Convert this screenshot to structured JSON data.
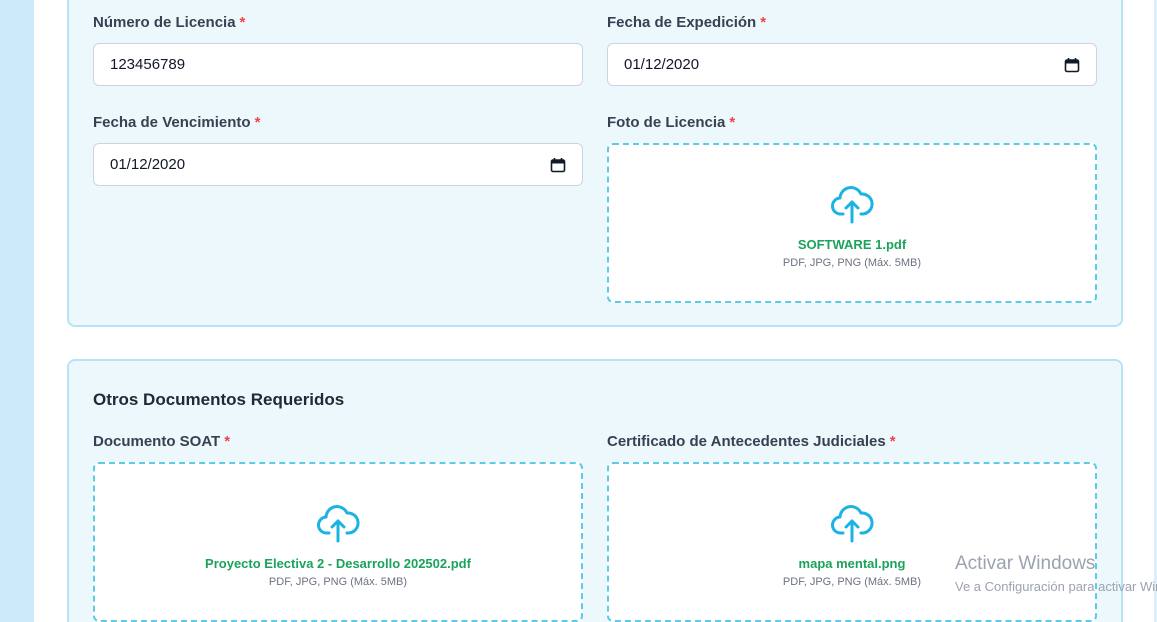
{
  "license": {
    "number_label": "Número de Licencia",
    "number_value": "123456789",
    "issue_label": "Fecha de Expedición",
    "issue_value": "01/12/2020",
    "expiry_label": "Fecha de Vencimiento",
    "expiry_value": "01/12/2020",
    "photo_label": "Foto de Licencia",
    "photo_file": "SOFTWARE 1.pdf",
    "photo_hint": "PDF, JPG, PNG (Máx. 5MB)"
  },
  "other_docs": {
    "title": "Otros Documentos Requeridos",
    "soat_label": "Documento SOAT",
    "soat_file": "Proyecto Electiva 2 - Desarrollo 202502.pdf",
    "soat_hint": "PDF, JPG, PNG (Máx. 5MB)",
    "records_label": "Certificado de Antecedentes Judiciales",
    "records_file": "mapa mental.png",
    "records_hint": "PDF, JPG, PNG (Máx. 5MB)"
  },
  "required_marker": "*",
  "icons": {
    "upload": "cloud-upload-icon",
    "calendar": "calendar-icon"
  },
  "colors": {
    "accent": "#1ab3e3",
    "file_name": "#1aa35a",
    "required": "#ef4444"
  },
  "watermark": {
    "title": "Activar Windows",
    "subtitle": "Ve a Configuración para activar Windows."
  }
}
